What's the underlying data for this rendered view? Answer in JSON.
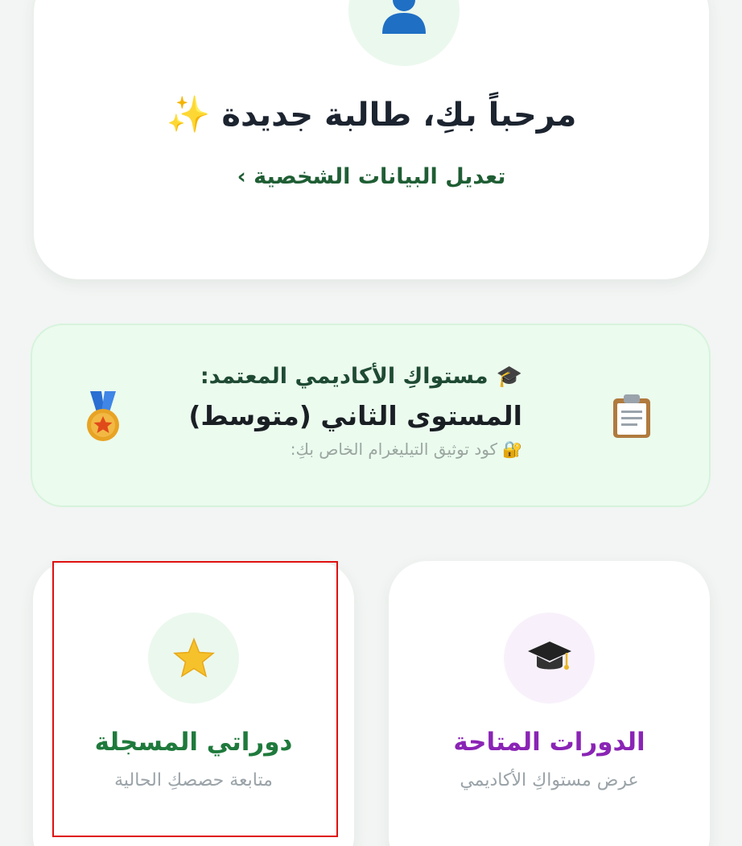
{
  "profile": {
    "avatar_icon": "user-avatar-icon",
    "welcome_text": "مرحباً بكِ، طالبة جديدة",
    "sparkle_icon": "sparkles-icon",
    "edit_link": "تعديل البيانات الشخصية ›"
  },
  "level_card": {
    "title": "مستواكِ الأكاديمي المعتمد:",
    "value": "المستوى الثاني (متوسط)",
    "telegram_hint": "كود توثيق التيليغرام الخاص بكِ:",
    "icons": [
      "graduation-cap-icon",
      "lock-key-icon",
      "clipboard-icon",
      "medal-icon"
    ]
  },
  "cards": {
    "available": {
      "title": "الدورات المتاحة",
      "subtitle": "عرض مستواكِ الأكاديمي",
      "icon": "graduation-cap-icon"
    },
    "mine": {
      "title": "دوراتي المسجلة",
      "subtitle": "متابعة حصصكِ الحالية",
      "icon": "star-icon"
    }
  },
  "colors": {
    "background": "#f2f5f3",
    "green_text": "#1f7a3c",
    "purple_text": "#8a24b5",
    "level_bg": "#ebfbee",
    "highlight": "#e01010"
  }
}
